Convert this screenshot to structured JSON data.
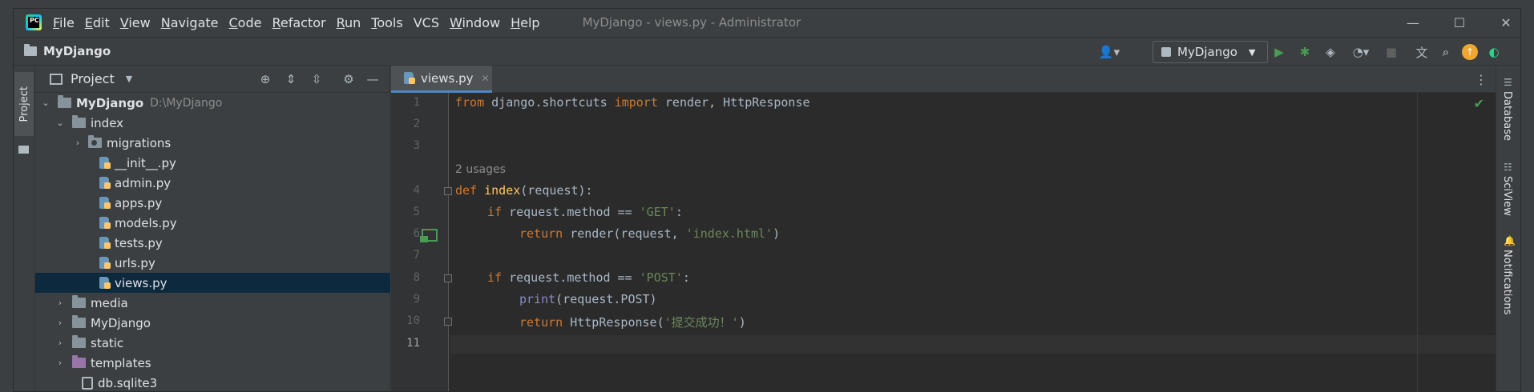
{
  "titlebar": {
    "menu": [
      {
        "label": "File",
        "mnemonic": "F",
        "rest": "ile"
      },
      {
        "label": "Edit",
        "mnemonic": "E",
        "rest": "dit"
      },
      {
        "label": "View",
        "mnemonic": "V",
        "rest": "iew"
      },
      {
        "label": "Navigate",
        "mnemonic": "N",
        "rest": "avigate"
      },
      {
        "label": "Code",
        "mnemonic": "C",
        "rest": "ode"
      },
      {
        "label": "Refactor",
        "mnemonic": "R",
        "rest": "efactor"
      },
      {
        "label": "Run",
        "mnemonic": "R",
        "rest": "un"
      },
      {
        "label": "Tools",
        "mnemonic": "T",
        "rest": "ools"
      },
      {
        "label": "VCS",
        "mnemonic": "",
        "rest": "VCS"
      },
      {
        "label": "Window",
        "mnemonic": "W",
        "rest": "indow"
      },
      {
        "label": "Help",
        "mnemonic": "H",
        "rest": "elp"
      }
    ],
    "window_title": "MyDjango - views.py - Administrator",
    "logo_text": "PC"
  },
  "navbar": {
    "project_name": "MyDjango",
    "run_config": "MyDjango"
  },
  "left_strip": {
    "label": "Project"
  },
  "project_panel": {
    "title": "Project",
    "tree": [
      {
        "label": "MyDjango",
        "hint": "D:\\MyDjango",
        "type": "root"
      },
      {
        "label": "index",
        "type": "folder-open"
      },
      {
        "label": "migrations",
        "type": "package"
      },
      {
        "label": "__init__.py",
        "type": "py"
      },
      {
        "label": "admin.py",
        "type": "py"
      },
      {
        "label": "apps.py",
        "type": "py"
      },
      {
        "label": "models.py",
        "type": "py"
      },
      {
        "label": "tests.py",
        "type": "py"
      },
      {
        "label": "urls.py",
        "type": "py"
      },
      {
        "label": "views.py",
        "type": "py",
        "selected": true
      },
      {
        "label": "media",
        "type": "folder"
      },
      {
        "label": "MyDjango",
        "type": "folder"
      },
      {
        "label": "static",
        "type": "folder"
      },
      {
        "label": "templates",
        "type": "folder-purple"
      },
      {
        "label": "db.sqlite3",
        "type": "db"
      }
    ]
  },
  "editor": {
    "tab": "views.py",
    "usages_hint": "2 usages",
    "line_numbers": [
      "1",
      "2",
      "3",
      "4",
      "5",
      "6",
      "7",
      "8",
      "9",
      "10",
      "11"
    ],
    "code": {
      "l1_from": "from",
      "l1_mod": " django.shortcuts ",
      "l1_import": "import",
      "l1_names": " render, HttpResponse",
      "l4_def": "def",
      "l4_name": "index",
      "l4_args": "(request):",
      "l5_if": "if",
      "l5_cond": " request.method == ",
      "l5_str": "'GET'",
      "l5_colon": ":",
      "l6_return": "return",
      "l6_call": " render(request, ",
      "l6_str": "'index.html'",
      "l6_end": ")",
      "l8_if": "if",
      "l8_cond": " request.method == ",
      "l8_str": "'POST'",
      "l8_colon": ":",
      "l9_print": "print",
      "l9_args": "(request.POST)",
      "l10_return": "return",
      "l10_call": " HttpResponse(",
      "l10_str": "'提交成功！'",
      "l10_end": ")"
    }
  },
  "right_strip": {
    "labels": [
      "Database",
      "SciView",
      "Notifications"
    ]
  },
  "colors": {
    "keyword": "#cc7832",
    "function": "#ffc66d",
    "string": "#6a8759",
    "builtin": "#8888c6",
    "selection": "#0d293e",
    "tab_accent": "#4a88c7"
  }
}
